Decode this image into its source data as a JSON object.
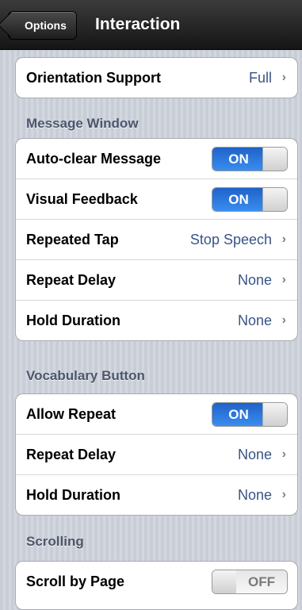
{
  "nav": {
    "back_label": "Options",
    "title": "Interaction"
  },
  "orientation": {
    "label": "Orientation Support",
    "value": "Full"
  },
  "message_window": {
    "header": "Message Window",
    "auto_clear": {
      "label": "Auto-clear Message",
      "toggle": "ON"
    },
    "visual_feedback": {
      "label": "Visual Feedback",
      "toggle": "ON"
    },
    "repeated_tap": {
      "label": "Repeated Tap",
      "value": "Stop Speech"
    },
    "repeat_delay": {
      "label": "Repeat Delay",
      "value": "None"
    },
    "hold_duration": {
      "label": "Hold Duration",
      "value": "None"
    }
  },
  "vocabulary_button": {
    "header": "Vocabulary Button",
    "allow_repeat": {
      "label": "Allow Repeat",
      "toggle": "ON"
    },
    "repeat_delay": {
      "label": "Repeat Delay",
      "value": "None"
    },
    "hold_duration": {
      "label": "Hold Duration",
      "value": "None"
    }
  },
  "scrolling": {
    "header": "Scrolling",
    "scroll_by_page": {
      "label": "Scroll by Page",
      "toggle": "OFF"
    }
  },
  "chevron": "›",
  "colors": {
    "accent_blue": "#2f7ae5",
    "value_text": "#385487",
    "section_header": "#4c566c"
  }
}
